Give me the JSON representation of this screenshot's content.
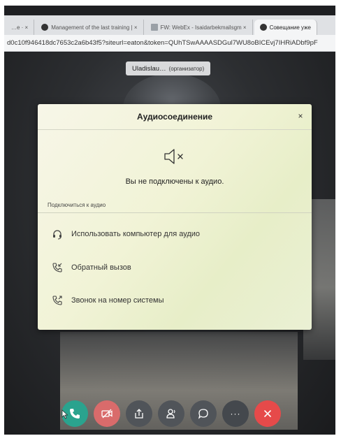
{
  "browser": {
    "tabs": [
      {
        "label": "…e · ×",
        "active": false
      },
      {
        "label": "Management of the last training | ×",
        "active": false
      },
      {
        "label": "FW: WebEx - Isaidarbekmailsgm ×",
        "active": false
      },
      {
        "label": "Совещание уже",
        "active": true
      }
    ],
    "url": "d0c10f946418dc7653c2a6b43f5?siteurl=eaton&token=QUhTSwAAAASDGul7WU8oBICEvj7IHRiADbf9pF"
  },
  "meeting": {
    "host_name": "Uladislau…",
    "host_role": "(организатор)"
  },
  "dialog": {
    "title": "Аудиосоединение",
    "close_label": "×",
    "status": "Вы не подключены к аудио.",
    "section_label": "Подключиться к аудио",
    "options": [
      {
        "label": "Использовать компьютер для аудио",
        "icon": "headset-icon"
      },
      {
        "label": "Обратный вызов",
        "icon": "phone-incoming-icon"
      },
      {
        "label": "Звонок на номер системы",
        "icon": "phone-outgoing-icon"
      }
    ]
  },
  "controls": {
    "items": [
      "audio",
      "video",
      "share",
      "participants",
      "chat",
      "more",
      "leave"
    ],
    "more_label": "···"
  },
  "colors": {
    "audio_button": "#2aa38e",
    "video_button": "#d96b6b",
    "leave_button": "#e64a4a",
    "dialog_background": "#f1f3d6"
  }
}
